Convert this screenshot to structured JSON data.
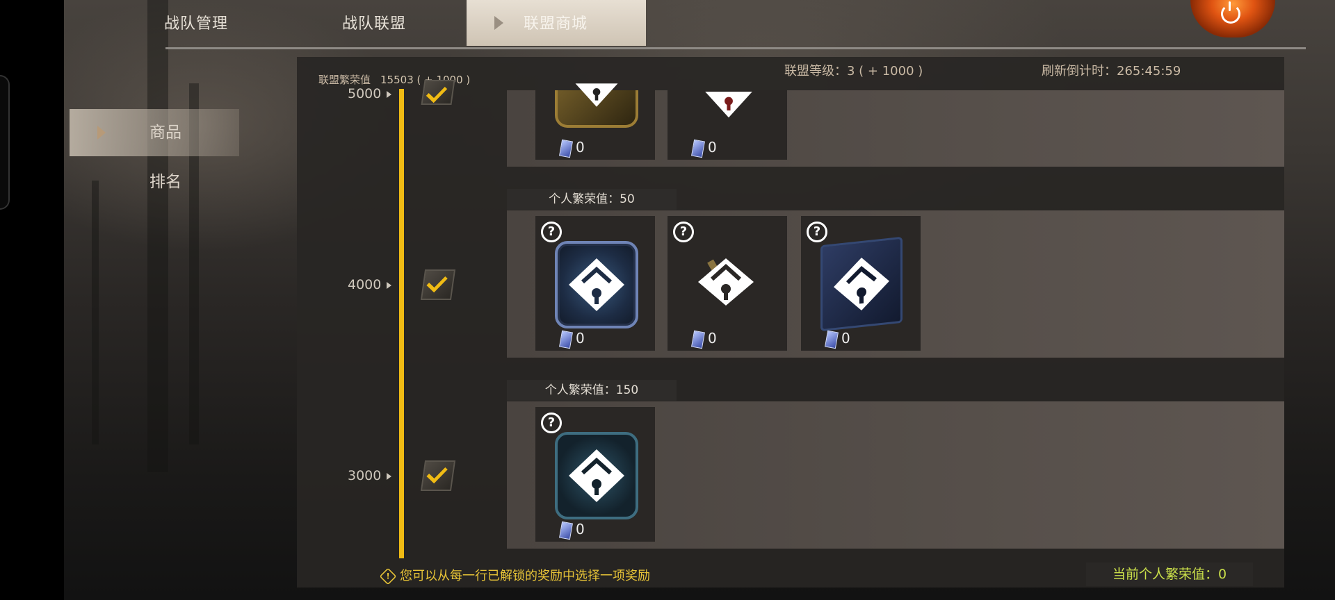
{
  "tabs": [
    {
      "label": "战队管理"
    },
    {
      "label": "战队联盟"
    },
    {
      "label": "联盟商城"
    }
  ],
  "sidebar": {
    "items": [
      {
        "label": "商品"
      },
      {
        "label": "排名"
      }
    ]
  },
  "header": {
    "prosperity_label": "联盟繁荣值",
    "prosperity_value": "15503 ( + 1000 )",
    "level_text": "联盟等级：3 ( + 1000 )",
    "refresh_text": "刷新倒计时：265:45:59"
  },
  "tiers": [
    {
      "level": "5000",
      "requirement": "",
      "items": [
        {
          "count": "0"
        },
        {
          "count": "0"
        }
      ]
    },
    {
      "level": "4000",
      "requirement": "个人繁荣值：50",
      "items": [
        {
          "count": "0"
        },
        {
          "count": "0"
        },
        {
          "count": "0"
        }
      ]
    },
    {
      "level": "3000",
      "requirement": "个人繁荣值：150",
      "items": [
        {
          "count": "0"
        }
      ]
    }
  ],
  "footer": {
    "tip": "您可以从每一行已解锁的奖励中选择一项奖励",
    "tip_icon_text": "!",
    "current": "当前个人繁荣值：0"
  },
  "help_glyph": "?",
  "icons": {
    "power": "power-icon",
    "lock": "lock-icon",
    "check": "check-icon",
    "card": "card-icon",
    "help": "help-icon"
  },
  "colors": {
    "accent": "#f0bb14",
    "current_value": "#cbe04a",
    "tip": "#e8c437"
  }
}
